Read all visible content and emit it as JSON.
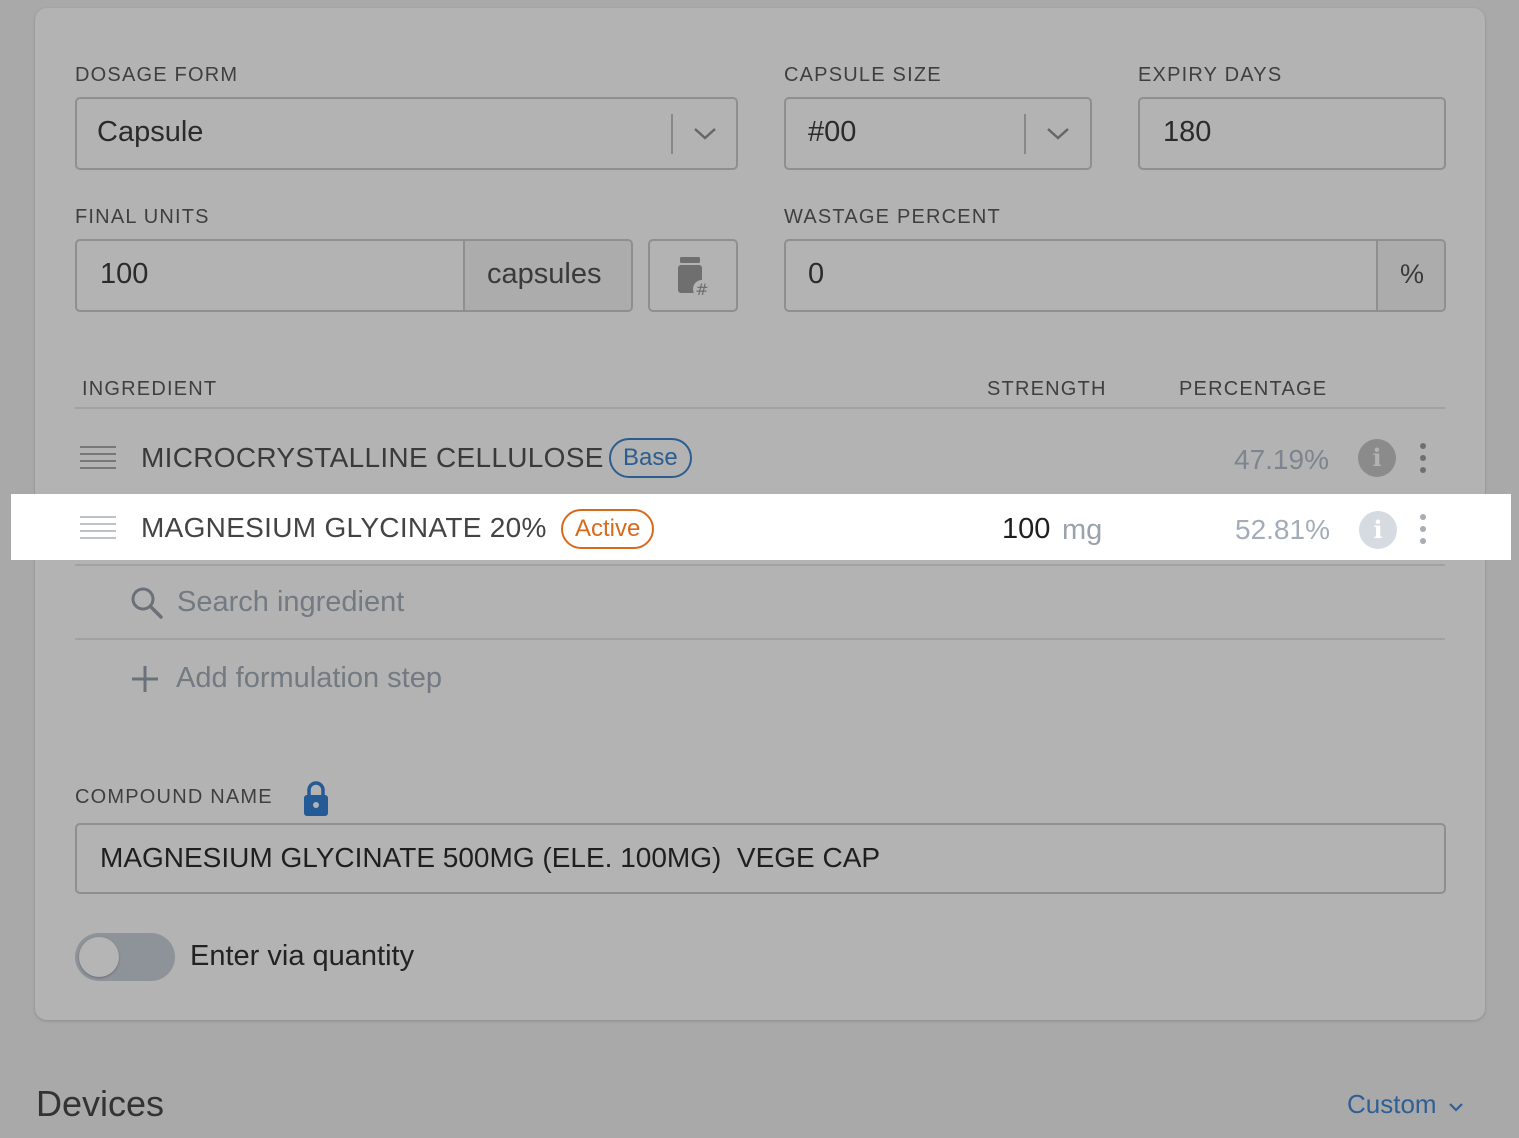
{
  "form": {
    "dosage_form": {
      "label": "DOSAGE FORM",
      "value": "Capsule"
    },
    "capsule_size": {
      "label": "CAPSULE SIZE",
      "value": "#00"
    },
    "expiry_days": {
      "label": "EXPIRY DAYS",
      "value": "180"
    },
    "final_units": {
      "label": "FINAL UNITS",
      "value": "100",
      "unit": "capsules"
    },
    "wastage_percent": {
      "label": "WASTAGE PERCENT",
      "value": "0",
      "unit": "%"
    }
  },
  "table": {
    "headers": {
      "ingredient": "INGREDIENT",
      "strength": "STRENGTH",
      "percentage": "PERCENTAGE"
    },
    "rows": [
      {
        "name": "MICROCRYSTALLINE CELLULOSE",
        "badge": "Base",
        "strength_value": "",
        "strength_unit": "",
        "percentage": "47.19%"
      },
      {
        "name": "MAGNESIUM GLYCINATE 20%",
        "badge": "Active",
        "strength_value": "100",
        "strength_unit": "mg",
        "percentage": "52.81%"
      }
    ],
    "search_placeholder": "Search ingredient",
    "add_step": "Add formulation step"
  },
  "compound": {
    "label": "COMPOUND NAME",
    "value": "MAGNESIUM GLYCINATE 500MG (ELE. 100MG)  VEGE CAP"
  },
  "toggle": {
    "label": "Enter via quantity",
    "on": false
  },
  "devices": {
    "title": "Devices",
    "menu": "Custom"
  },
  "colors": {
    "base_badge": "#2c5d8f",
    "active_badge": "#d86a1e",
    "lock": "#245a96",
    "link": "#2f5f94"
  },
  "icons": [
    "chevron-down-icon",
    "bottle-hash-icon",
    "drag-handle-icon",
    "info-icon",
    "kebab-icon",
    "search-icon",
    "plus-icon",
    "lock-icon"
  ]
}
